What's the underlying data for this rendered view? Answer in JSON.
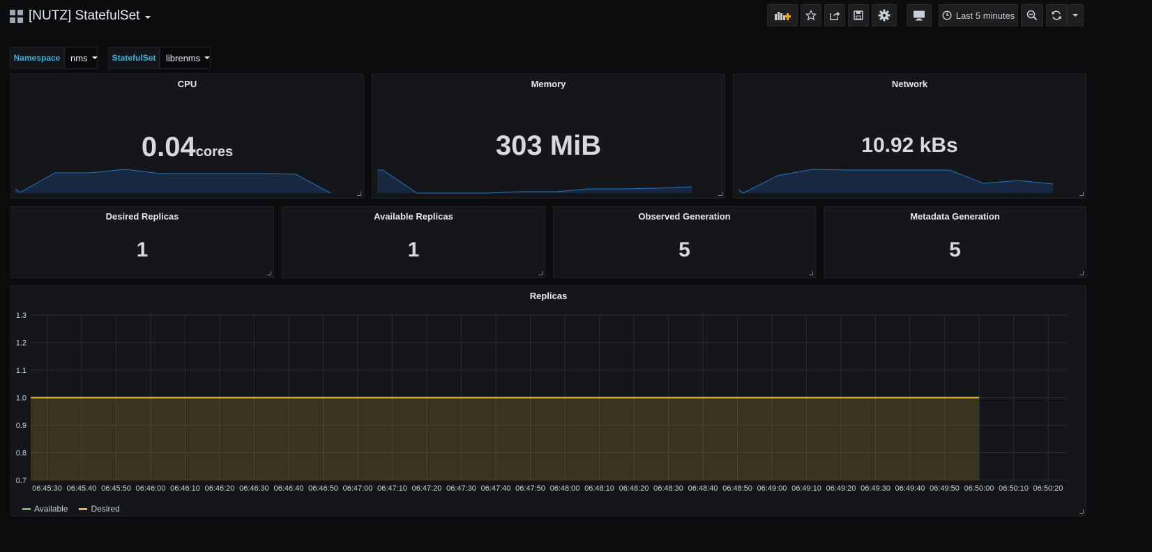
{
  "header": {
    "title": "[NUTZ] StatefulSet",
    "time_range": "Last 5 minutes"
  },
  "variables": [
    {
      "label": "Namespace",
      "value": "nms"
    },
    {
      "label": "StatefulSet",
      "value": "librenms"
    }
  ],
  "colors": {
    "accent": "#33b5e5",
    "spark_line": "#1f78c1",
    "spark_fill": "#172840",
    "available": "#7eb26d",
    "desired": "#eab839"
  },
  "stats": {
    "cpu": {
      "title": "CPU",
      "value": "0.04",
      "unit": "cores"
    },
    "memory": {
      "title": "Memory",
      "value": "303 MiB"
    },
    "network": {
      "title": "Network",
      "value": "10.92 kBs"
    }
  },
  "singlestats": [
    {
      "title": "Desired Replicas",
      "value": "1"
    },
    {
      "title": "Available Replicas",
      "value": "1"
    },
    {
      "title": "Observed Generation",
      "value": "5"
    },
    {
      "title": "Metadata Generation",
      "value": "5"
    }
  ],
  "replicas_panel": {
    "title": "Replicas"
  },
  "chart_data": {
    "type": "line",
    "title": "Replicas",
    "ylim": [
      0.7,
      1.3
    ],
    "yticks": [
      "1.3",
      "1.2",
      "1.1",
      "1.0",
      "0.9",
      "0.8",
      "0.7"
    ],
    "x": [
      "06:45:30",
      "06:45:40",
      "06:45:50",
      "06:46:00",
      "06:46:10",
      "06:46:20",
      "06:46:30",
      "06:46:40",
      "06:46:50",
      "06:47:00",
      "06:47:10",
      "06:47:20",
      "06:47:30",
      "06:47:40",
      "06:47:50",
      "06:48:00",
      "06:48:10",
      "06:48:20",
      "06:48:30",
      "06:48:40",
      "06:48:50",
      "06:49:00",
      "06:49:10",
      "06:49:20",
      "06:49:30",
      "06:49:40",
      "06:49:50",
      "06:50:00",
      "06:50:10",
      "06:50:20"
    ],
    "series": [
      {
        "name": "Available",
        "color": "#7eb26d",
        "values": [
          1,
          1,
          1,
          1,
          1,
          1,
          1,
          1,
          1,
          1,
          1,
          1,
          1,
          1,
          1,
          1,
          1,
          1,
          1,
          1,
          1,
          1,
          1,
          1,
          1,
          1,
          1,
          1,
          null,
          null
        ]
      },
      {
        "name": "Desired",
        "color": "#eab839",
        "values": [
          1,
          1,
          1,
          1,
          1,
          1,
          1,
          1,
          1,
          1,
          1,
          1,
          1,
          1,
          1,
          1,
          1,
          1,
          1,
          1,
          1,
          1,
          1,
          1,
          1,
          1,
          1,
          1,
          null,
          null
        ]
      }
    ],
    "legend": "bottom-left",
    "grid": true
  }
}
